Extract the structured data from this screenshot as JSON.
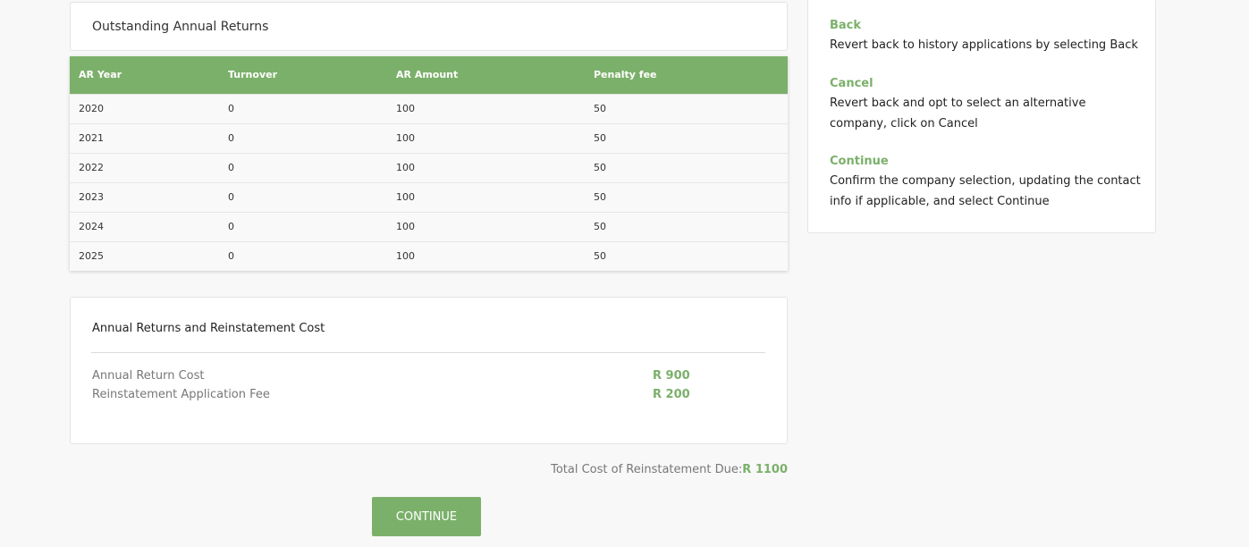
{
  "outstanding": {
    "title": "Outstanding Annual Returns",
    "columns": [
      "AR Year",
      "Turnover",
      "AR Amount",
      "Penalty fee"
    ],
    "rows": [
      [
        "2020",
        "0",
        "100",
        "50"
      ],
      [
        "2021",
        "0",
        "100",
        "50"
      ],
      [
        "2022",
        "0",
        "100",
        "50"
      ],
      [
        "2023",
        "0",
        "100",
        "50"
      ],
      [
        "2024",
        "0",
        "100",
        "50"
      ],
      [
        "2025",
        "0",
        "100",
        "50"
      ]
    ]
  },
  "cost": {
    "title": "Annual Returns and Reinstatement Cost",
    "items": [
      {
        "label": "Annual Return Cost",
        "value": "R 900"
      },
      {
        "label": "Reinstatement Application Fee",
        "value": "R 200"
      }
    ],
    "total_label": "Total Cost of Reinstatement Due:",
    "total_value": "R 1100"
  },
  "actions": {
    "continue_label": "CONTINUE"
  },
  "help": {
    "items": [
      {
        "title": "Back",
        "desc": "Revert back to history applications by selecting Back"
      },
      {
        "title": "Cancel",
        "desc": "Revert back and opt to select an alternative company, click on Cancel"
      },
      {
        "title": "Continue",
        "desc": "Confirm the company selection, updating the contact info if applicable, and select Continue"
      }
    ]
  },
  "colors": {
    "accent": "#7bb06a",
    "background": "#f8f8f8"
  }
}
